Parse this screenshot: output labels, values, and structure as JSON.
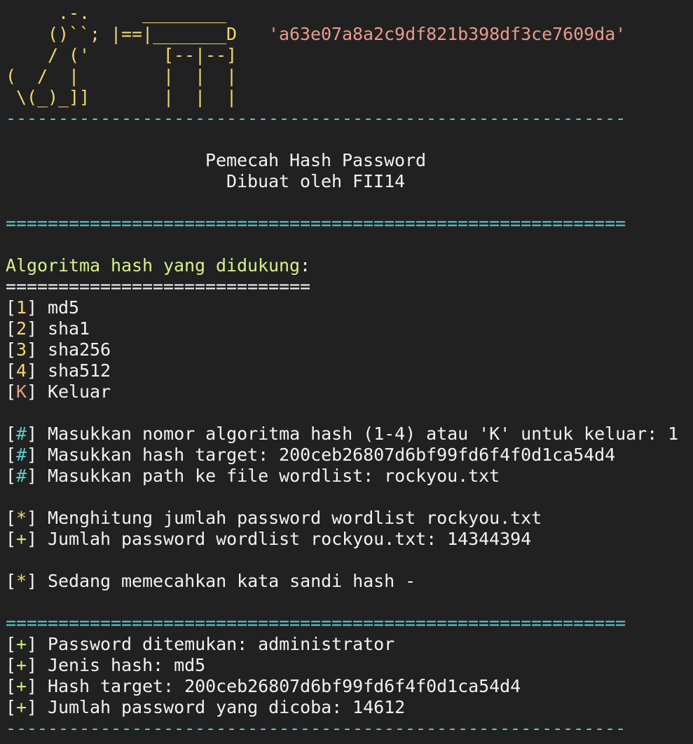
{
  "colors": {
    "background": "#212121",
    "text": "#f2f2f2",
    "banner": "#f5d76e",
    "hash_literal": "#e89a8e",
    "divider": "#5fc8c8",
    "heading": "#d8f08c",
    "marker_yellow": "#f5d76e",
    "marker_pink": "#e89a8e",
    "marker_cyan": "#5fc8c8",
    "marker_green": "#c8ef78"
  },
  "banner": {
    "art_line1": "     .-.     ________",
    "art_line2": "    ()``; |==|_______D   ",
    "art_hash": "'a63e07a8a2c9df821b398df3ce7609da'",
    "art_line3": "    / ('       [--|--]",
    "art_line4": "(  /  |        |  |  |",
    "art_line5": " \\(_)_]]       |  |  |"
  },
  "divider_dash": "-----------------------------------------------------------",
  "divider_eq": "===========================================================",
  "divider_short": "=============================",
  "title": {
    "line1": "                   Pemecah Hash Password",
    "line2": "                     Dibuat oleh FII14"
  },
  "menu": {
    "heading": "Algoritma hash yang didukung",
    "heading_colon": ":",
    "items": [
      {
        "key": "1",
        "label": " md5"
      },
      {
        "key": "2",
        "label": " sha1"
      },
      {
        "key": "3",
        "label": " sha256"
      },
      {
        "key": "4",
        "label": " sha512"
      },
      {
        "key": "K",
        "label": " Keluar"
      }
    ]
  },
  "prompts": [
    {
      "marker": "#",
      "text": " Masukkan nomor algoritma hash (1-4) atau 'K' untuk keluar: 1"
    },
    {
      "marker": "#",
      "text": " Masukkan hash target: 200ceb26807d6bf99fd6f4f0d1ca54d4"
    },
    {
      "marker": "#",
      "text": " Masukkan path ke file wordlist: rockyou.txt"
    }
  ],
  "progress": [
    {
      "marker": "*",
      "text": " Menghitung jumlah password wordlist rockyou.txt"
    },
    {
      "marker": "+",
      "text": " Jumlah password wordlist rockyou.txt: 14344394"
    }
  ],
  "status": {
    "marker": "*",
    "text": " Sedang memecahkan kata sandi hash -"
  },
  "results": [
    {
      "marker": "+",
      "text": " Password ditemukan: administrator"
    },
    {
      "marker": "+",
      "text": " Jenis hash: md5"
    },
    {
      "marker": "+",
      "text": " Hash target: 200ceb26807d6bf99fd6f4f0d1ca54d4"
    },
    {
      "marker": "+",
      "text": " Jumlah password yang dicoba: 14612"
    }
  ],
  "brackets": {
    "open": "[",
    "close": "]"
  }
}
